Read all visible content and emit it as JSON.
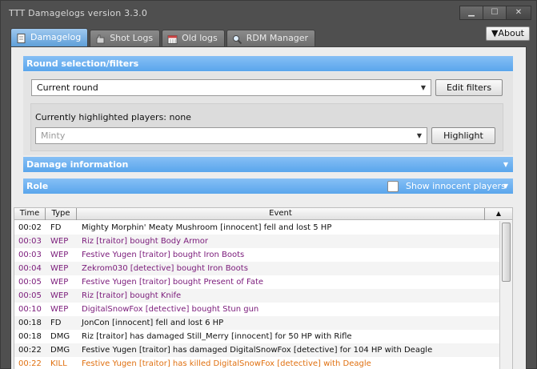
{
  "window": {
    "title": "TTT Damagelogs version 3.3.0",
    "buttons": {
      "minimize": "▁",
      "maximize": "☐",
      "close": "✕"
    }
  },
  "about_label": "▼About",
  "tabs": [
    {
      "label": "Damagelog",
      "icon": "page-icon",
      "active": true
    },
    {
      "label": "Shot Logs",
      "icon": "hand-icon",
      "active": false
    },
    {
      "label": "Old logs",
      "icon": "calendar-icon",
      "active": false
    },
    {
      "label": "RDM Manager",
      "icon": "magnifier-icon",
      "active": false
    }
  ],
  "sections": {
    "filters": "Round selection/filters",
    "damage": "Damage information",
    "role": "Role"
  },
  "round_select": {
    "value": "Current round"
  },
  "edit_filters_label": "Edit filters",
  "highlight": {
    "text": "Currently highlighted players: none",
    "player_select": "Minty",
    "button_label": "Highlight"
  },
  "show_innocent_label": "Show innocent players",
  "table": {
    "headers": [
      "Time",
      "Type",
      "Event"
    ],
    "rows": [
      {
        "time": "00:02",
        "type": "FD",
        "event": "Mighty Morphin' Meaty Mushroom [innocent] fell and lost 5 HP",
        "color": "#111111"
      },
      {
        "time": "00:03",
        "type": "WEP",
        "event": "Riz [traitor] bought Body Armor",
        "color": "#7a1a7a"
      },
      {
        "time": "00:03",
        "type": "WEP",
        "event": "Festive Yugen [traitor] bought Iron Boots",
        "color": "#7a1a7a"
      },
      {
        "time": "00:04",
        "type": "WEP",
        "event": "Zekrom030 [detective] bought Iron Boots",
        "color": "#7a1a7a"
      },
      {
        "time": "00:05",
        "type": "WEP",
        "event": "Festive Yugen [traitor] bought Present of Fate",
        "color": "#7a1a7a"
      },
      {
        "time": "00:05",
        "type": "WEP",
        "event": "Riz [traitor] bought Knife",
        "color": "#7a1a7a"
      },
      {
        "time": "00:10",
        "type": "WEP",
        "event": "DigitalSnowFox [detective] bought Stun gun",
        "color": "#7a1a7a"
      },
      {
        "time": "00:18",
        "type": "FD",
        "event": "JonCon [innocent] fell and lost 6 HP",
        "color": "#111111"
      },
      {
        "time": "00:18",
        "type": "DMG",
        "event": "Riz [traitor] has damaged Still_Merry [innocent] for 50 HP with Rifle",
        "color": "#111111"
      },
      {
        "time": "00:22",
        "type": "DMG",
        "event": "Festive Yugen [traitor] has damaged DigitalSnowFox [detective] for 104 HP with Deagle",
        "color": "#111111"
      },
      {
        "time": "00:22",
        "type": "KILL",
        "event": "Festive Yugen [traitor] has killed DigitalSnowFox [detective] with Deagle",
        "color": "#e07010"
      }
    ]
  }
}
